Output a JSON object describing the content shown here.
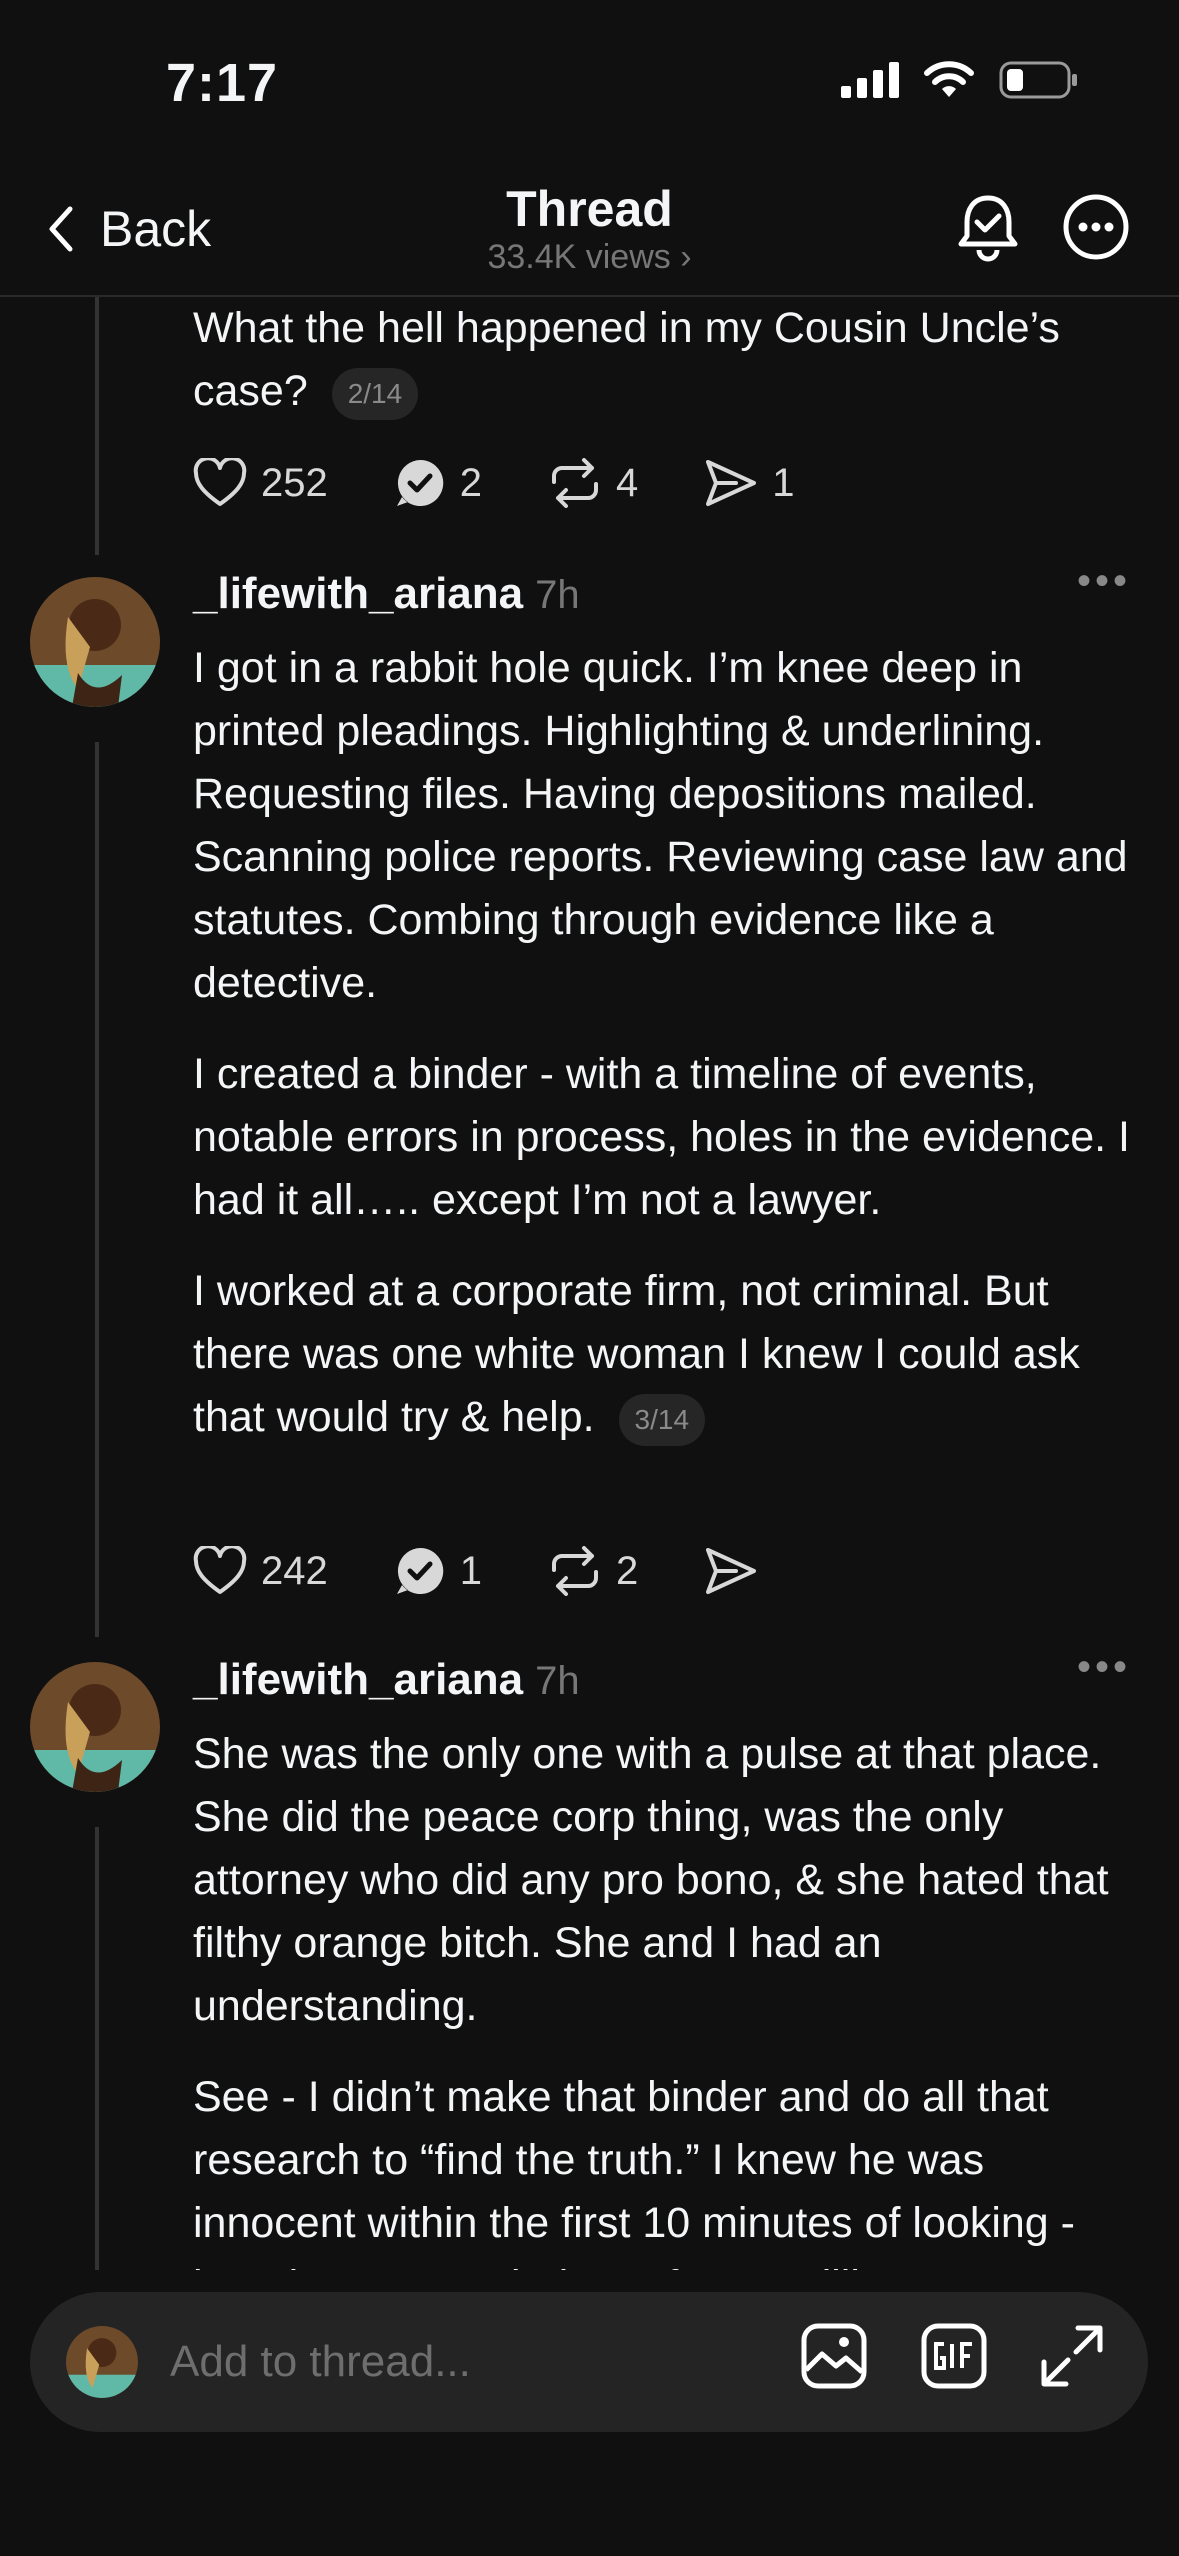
{
  "status_bar": {
    "time": "7:17"
  },
  "nav": {
    "back_label": "Back",
    "title": "Thread",
    "views": "33.4K views"
  },
  "posts": [
    {
      "paragraphs": [
        "What the hell happened in my Cousin Uncle’s case?"
      ],
      "counter": "2/14",
      "likes": "252",
      "replies": "2",
      "reposts": "4",
      "shares": "1"
    },
    {
      "username": "_lifewith_ariana",
      "time": "7h",
      "paragraphs": [
        "I got in a rabbit hole quick. I’m knee deep in printed pleadings. Highlighting & underlining. Requesting files. Having depositions mailed. Scanning police reports. Reviewing case law and statutes. Combing through evidence like a detective.",
        "I created a binder - with a timeline of events, notable errors in process, holes in the evidence. I had it all….. except I’m not a lawyer.",
        "I worked at a corporate firm, not criminal. But there was one white woman I knew I could ask that would try & help."
      ],
      "counter": "3/14",
      "likes": "242",
      "replies": "1",
      "reposts": "2"
    },
    {
      "username": "_lifewith_ariana",
      "time": "7h",
      "paragraphs": [
        "She was the only one with a pulse at that place. She did the peace corp thing, was the only attorney who did any pro bono, & she hated that filthy orange bitch. She and I had an understanding.",
        "See - I didn’t make that binder and do all that research to “find the truth.” I knew he was innocent within the first 10 minutes of looking - but I knew I needed proof. “Due diligence”"
      ]
    }
  ],
  "composer": {
    "placeholder": "Add to thread..."
  },
  "colors": {
    "background": "#101010",
    "text": "#f3f5f7",
    "muted": "#777777",
    "composer": "#242424"
  }
}
